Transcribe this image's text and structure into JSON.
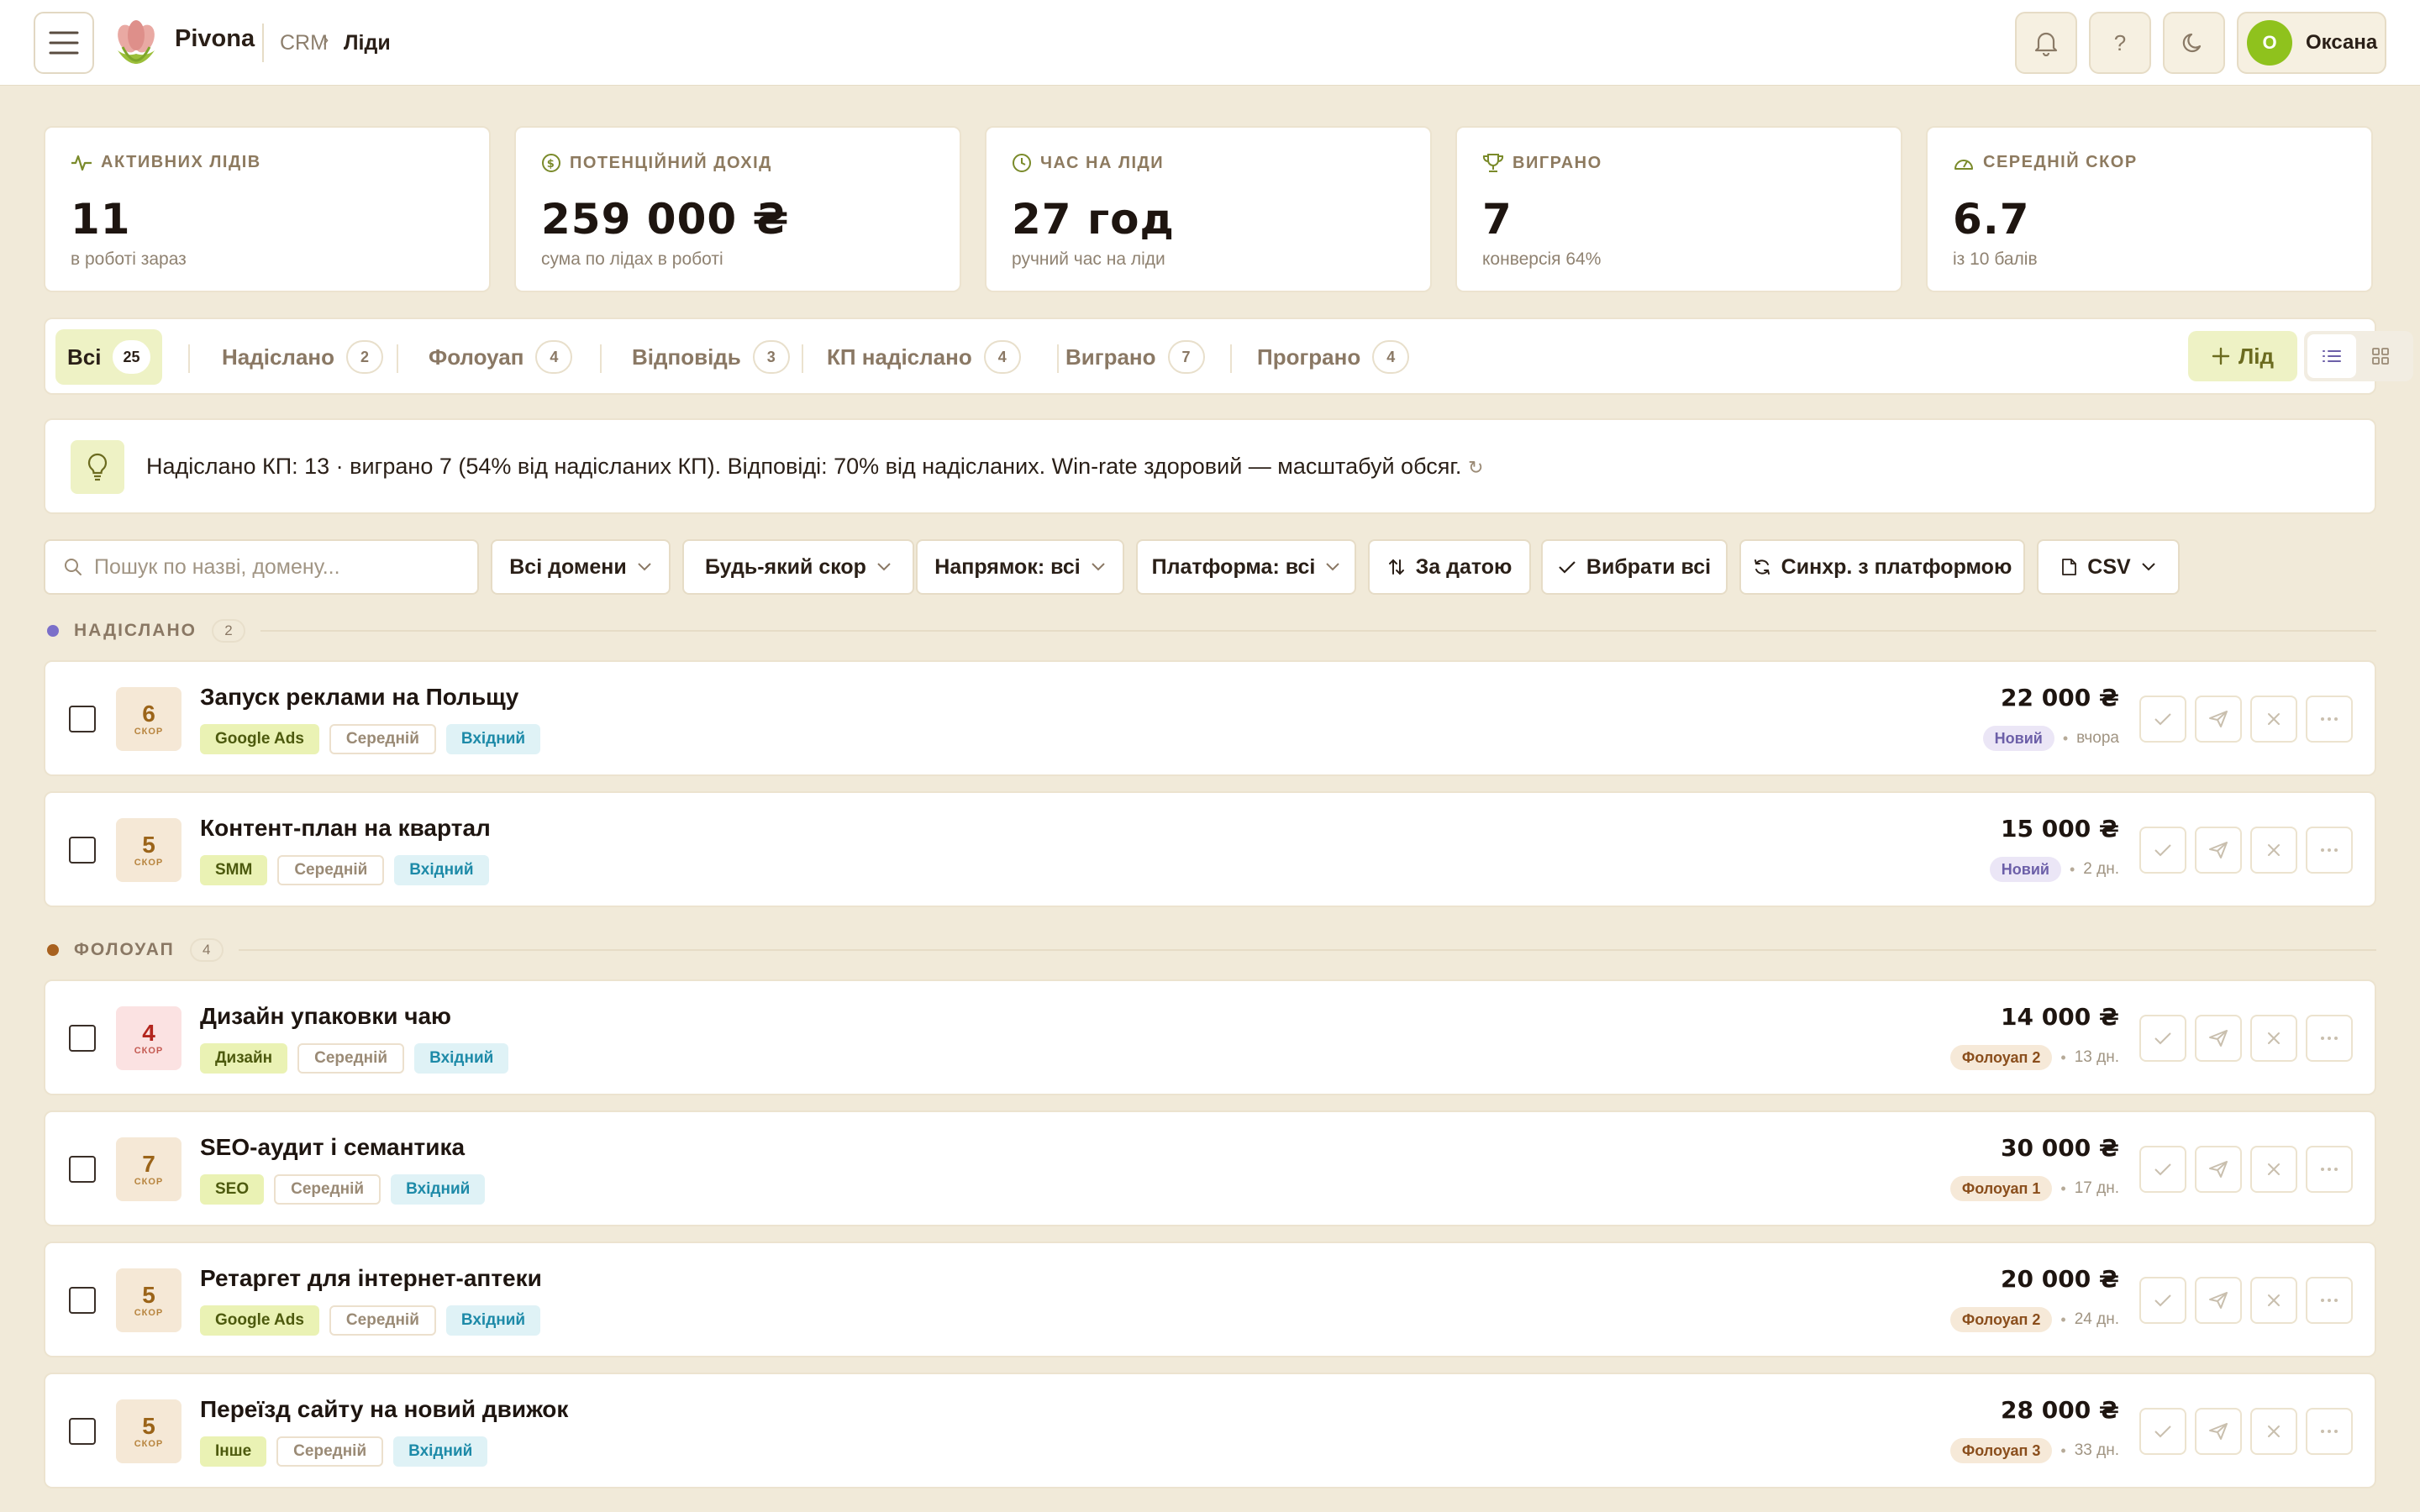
{
  "app": {
    "brand": "Pivona",
    "breadcrumb": {
      "root": "CRM",
      "current": "Ліди"
    }
  },
  "user": {
    "initial": "O",
    "name": "Оксана"
  },
  "stats": [
    {
      "label": "Активних лідів",
      "value": "11",
      "sub": "в роботі зараз",
      "icon": "activity-icon"
    },
    {
      "label": "Потенційний дохід",
      "value": "259 000 ₴",
      "sub": "сума по лідах в роботі",
      "icon": "coin-icon"
    },
    {
      "label": "Час на ліди",
      "value": "27 год",
      "sub": "ручний час на ліди",
      "icon": "clock-icon"
    },
    {
      "label": "Виграно",
      "value": "7",
      "sub": "конверсія 64%",
      "icon": "trophy-icon"
    },
    {
      "label": "Середній скор",
      "value": "6.7",
      "sub": "із 10 балів",
      "icon": "gauge-icon"
    }
  ],
  "tabs": [
    {
      "label": "Всі",
      "count": "25",
      "active": true
    },
    {
      "label": "Надіслано",
      "count": "2"
    },
    {
      "label": "Фолоуап",
      "count": "4"
    },
    {
      "label": "Відповідь",
      "count": "3"
    },
    {
      "label": "КП надіслано",
      "count": "4"
    },
    {
      "label": "Виграно",
      "count": "7"
    },
    {
      "label": "Програно",
      "count": "4"
    }
  ],
  "add_lead_label": "Лід",
  "insight": {
    "text": "Надіслано КП: 13 · виграно 7 (54% від надісланих КП). Відповіді: 70% від надісланих. Win-rate здоровий — масштабуй обсяг."
  },
  "filters": {
    "search_placeholder": "Пошук по назві, домену...",
    "domains": "Всі домени",
    "score": "Будь-який скор",
    "direction": "Напрямок: всі",
    "platform": "Платформа: всі",
    "sort": "За датою",
    "select_all": "Вибрати всі",
    "sync": "Синхр. з платформою",
    "csv": "CSV"
  },
  "groups": [
    {
      "name": "НАДІСЛАНО",
      "count": "2",
      "color": "#7b6fc9"
    },
    {
      "name": "ФОЛОУАП",
      "count": "4",
      "color": "#a8611f"
    }
  ],
  "score_label": "СКОР",
  "leads": [
    {
      "score": "6",
      "title": "Запуск реклами на Польщу",
      "domain": "Google Ads",
      "level": "Середній",
      "direction": "Вхідний",
      "amount": "22 000 ₴",
      "status": "Новий",
      "time": "вчора"
    },
    {
      "score": "5",
      "title": "Контент-план на квартал",
      "domain": "SMM",
      "level": "Середній",
      "direction": "Вхідний",
      "amount": "15 000 ₴",
      "status": "Новий",
      "time": "2 дн."
    },
    {
      "score": "4",
      "title": "Дизайн упаковки чаю",
      "domain": "Дизайн",
      "level": "Середній",
      "direction": "Вхідний",
      "amount": "14 000 ₴",
      "status": "Фолоуап 2",
      "time": "13 дн."
    },
    {
      "score": "7",
      "title": "SEO-аудит і семантика",
      "domain": "SEO",
      "level": "Середній",
      "direction": "Вхідний",
      "amount": "30 000 ₴",
      "status": "Фолоуап 1",
      "time": "17 дн."
    },
    {
      "score": "5",
      "title": "Ретаргет для інтернет-аптеки",
      "domain": "Google Ads",
      "level": "Середній",
      "direction": "Вхідний",
      "amount": "20 000 ₴",
      "status": "Фолоуап 2",
      "time": "24 дн."
    },
    {
      "score": "5",
      "title": "Переїзд сайту на новий движок",
      "domain": "Інше",
      "level": "Середній",
      "direction": "Вхідний",
      "amount": "28 000 ₴",
      "status": "Фолоуап 3",
      "time": "33 дн."
    }
  ]
}
